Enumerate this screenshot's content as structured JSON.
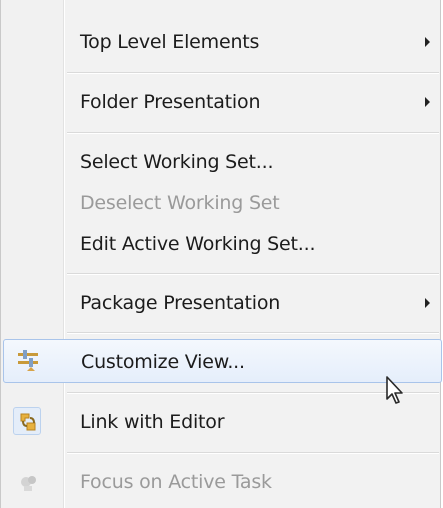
{
  "menu": {
    "items": [
      {
        "label": "Top Level Elements",
        "submenu": true,
        "enabled": true
      },
      {
        "label": "Folder Presentation",
        "submenu": true,
        "enabled": true
      },
      {
        "label": "Select Working Set...",
        "submenu": false,
        "enabled": true
      },
      {
        "label": "Deselect Working Set",
        "submenu": false,
        "enabled": false
      },
      {
        "label": "Edit Active Working Set...",
        "submenu": false,
        "enabled": true
      },
      {
        "label": "Package Presentation",
        "submenu": true,
        "enabled": true
      },
      {
        "label": "Customize View...",
        "submenu": false,
        "enabled": true,
        "highlighted": true,
        "icon": "filter-icon"
      },
      {
        "label": "Link with Editor",
        "submenu": false,
        "enabled": true,
        "checked": true,
        "icon": "link-editor-icon"
      },
      {
        "label": "Focus on Active Task",
        "submenu": false,
        "enabled": false,
        "icon": "focus-task-icon"
      }
    ]
  },
  "colors": {
    "highlight_border": "#a9c4ea",
    "highlight_fill": "#e5eefb",
    "disabled_text": "#9a9a9a",
    "text": "#1c1c1c"
  }
}
